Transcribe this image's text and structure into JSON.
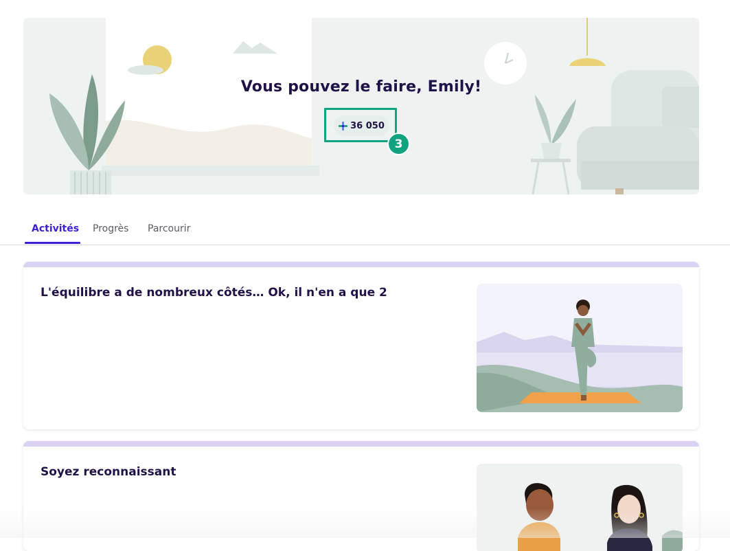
{
  "hero": {
    "title": "Vous pouvez le faire, Emily!",
    "points": "36 050",
    "step_badge": "3"
  },
  "tabs": [
    {
      "label": "Activités",
      "active": true
    },
    {
      "label": "Progrès",
      "active": false
    },
    {
      "label": "Parcourir",
      "active": false
    }
  ],
  "cards": [
    {
      "title": "L'équilibre a de nombreux côtés… Ok, il n'en a que 2"
    },
    {
      "title": "Soyez reconnaissant"
    }
  ],
  "colors": {
    "accent": "#3d1fd6",
    "highlight": "#10a37f",
    "title": "#1f1247",
    "card_top": "#d9d2f3"
  },
  "icons": [
    "plus-icon"
  ]
}
